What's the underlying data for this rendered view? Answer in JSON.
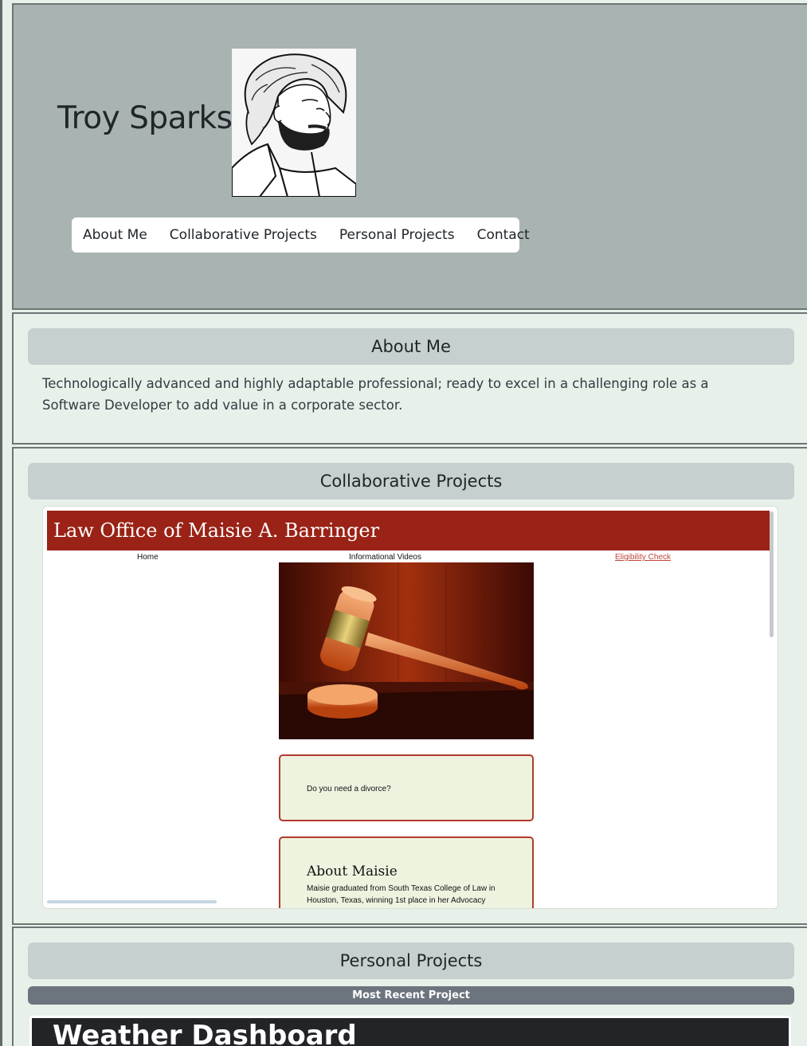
{
  "header": {
    "name": "Troy Sparks",
    "nav": [
      "About Me",
      "Collaborative Projects",
      "Personal Projects",
      "Contact"
    ]
  },
  "about": {
    "title": "About Me",
    "text": "Technologically advanced and highly adaptable professional; ready to excel in a challenging role as a Software Developer to add value in a corporate sector."
  },
  "collab": {
    "title": "Collaborative Projects",
    "preview": {
      "banner": "Law Office of Maisie A. Barringer",
      "nav_home": "Home",
      "nav_videos": "Informational Videos",
      "nav_eligibility": "Eligibility Check",
      "card1_text": "Do you need a divorce?",
      "card2_heading": "About Maisie",
      "card2_text": "Maisie graduated from South Texas College of Law in Houston, Texas, winning 1st place in her Advocacy"
    }
  },
  "personal": {
    "title": "Personal Projects",
    "recent_label": "Most Recent Project",
    "project_title": "Weather Dashboard"
  },
  "colors": {
    "header_bg": "#a8b3b2",
    "page_bg": "#e8f0ea",
    "section_header_bg": "#c6d1cf",
    "law_banner": "#9a2216",
    "recent_bar": "#6c757d"
  }
}
